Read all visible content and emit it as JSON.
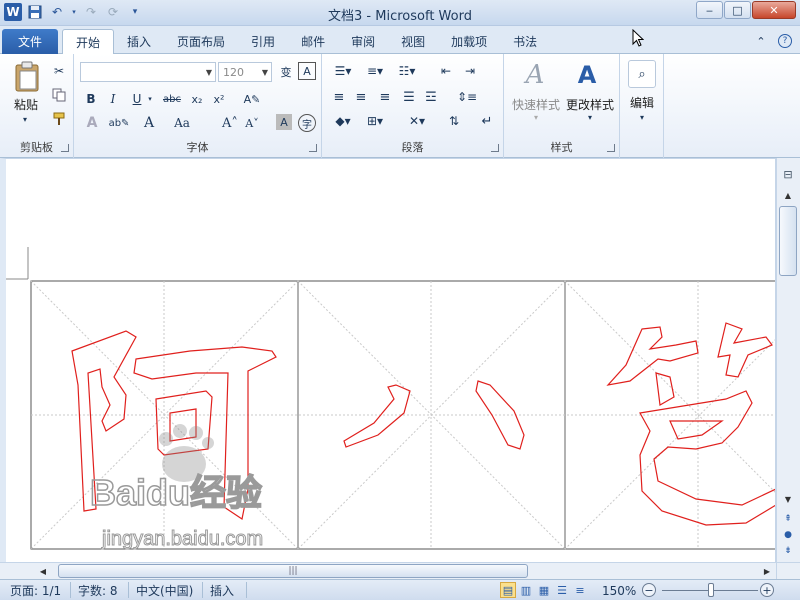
{
  "window": {
    "title": "文档3 - Microsoft Word",
    "logo_letter": "W"
  },
  "ribbon_tabs": {
    "file": "文件",
    "tabs": [
      "开始",
      "插入",
      "页面布局",
      "引用",
      "邮件",
      "审阅",
      "视图",
      "加载项",
      "书法"
    ],
    "active_index": 0
  },
  "clipboard": {
    "paste_label": "粘贴",
    "group_label": "剪贴板"
  },
  "font": {
    "font_name_value": "",
    "font_size_value": "120",
    "group_label": "字体"
  },
  "paragraph": {
    "group_label": "段落"
  },
  "styles": {
    "quick_styles_label": "快速样式",
    "change_styles_label": "更改样式",
    "group_label": "样式"
  },
  "editing": {
    "label": "编辑"
  },
  "document": {
    "characters": [
      "阿",
      "八",
      "笆"
    ],
    "watermark_main": "Baidu经验",
    "watermark_url": "jingyan.baidu.com",
    "outline_color": "#e0201d"
  },
  "statusbar": {
    "page": "页面: 1/1",
    "words": "字数: 8",
    "language": "中文(中国)",
    "mode": "插入",
    "zoom": "150%"
  },
  "colors": {
    "accent": "#2a5da8",
    "titlebar": "#dfe9f5"
  }
}
